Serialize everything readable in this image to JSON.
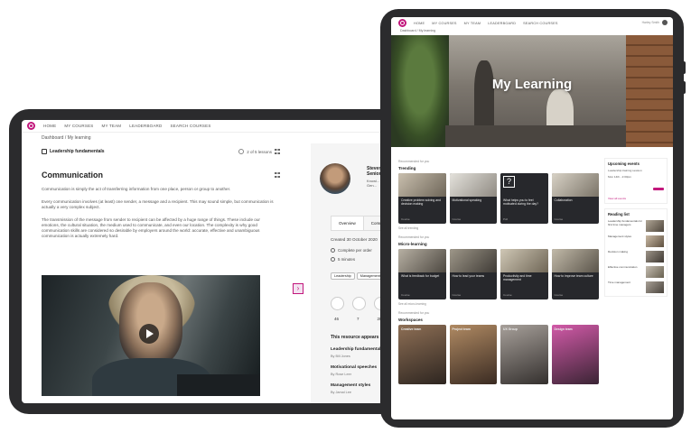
{
  "colors": {
    "brand": "#c2177c",
    "device": "#2b2b2d"
  },
  "landscape": {
    "nav": [
      "HOME",
      "MY COURSES",
      "MY TEAM",
      "LEADERBOARD",
      "SEARCH COURSES"
    ],
    "breadcrumb": "Dashboard  /  My learning",
    "course_title": "Leadership fundamentals",
    "progress_label": "2 of 5 lessons",
    "lesson_title": "Communication",
    "paragraphs": [
      "Communication is simply the act of transferring information from one place, person or group to another.",
      "Every communication involves (at least) one sender, a message and a recipient. This may sound simple, but communication is actually a very complex subject.",
      "The transmission of the message from sender to recipient can be affected by a huge range of things. These include our emotions, the cultural situation, the medium used to communicate, and even our location. The complexity is why good communication skills are considered so desirable by employers around the world: accurate, effective and unambiguous communication is actually extremely hard."
    ],
    "side_toggle_icon": "expand-icon",
    "author": {
      "name": "Steven Senior",
      "meta": "Knowl... at Gen..."
    },
    "tabs": [
      "Overview",
      "Comm"
    ],
    "created": "Created 30 October 2020",
    "info_rows": [
      "Complete per order",
      "5 minutes"
    ],
    "tags": [
      "Leadership",
      "Management"
    ],
    "stats": [
      "46",
      "7",
      "28"
    ],
    "appears_label": "This resource appears in:",
    "related": [
      {
        "title": "Leadership fundamentals",
        "author": "By Bill Jones"
      },
      {
        "title": "Motivational speeches",
        "author": "By Rose Leer"
      },
      {
        "title": "Management styles",
        "author": "By Jamal Lee"
      }
    ]
  },
  "portrait": {
    "nav": [
      "HOME",
      "MY COURSES",
      "MY TEAM",
      "LEADERBOARD",
      "SEARCH COURSES"
    ],
    "user": "Harley Smith",
    "breadcrumb": "Dashboard  /  My learning",
    "hero_title": "My Learning",
    "sections": [
      {
        "small": "Recommended for you",
        "title": "Trending",
        "cards": [
          {
            "title": "Creative problem solving and decision making",
            "type": "Course",
            "thumb": "office"
          },
          {
            "title": "Motivational speaking",
            "type": "Course",
            "thumb": "office"
          },
          {
            "title": "What helps you to feel motivated during the day?",
            "type": "Poll",
            "thumb": "question"
          },
          {
            "title": "Collaboration",
            "type": "Course",
            "thumb": "office"
          }
        ],
        "see_all": "See all trending"
      },
      {
        "small": "Recommended for you",
        "title": "Micro-learning",
        "cards": [
          {
            "title": "What is feedback for budget",
            "type": "Course",
            "thumb": "office"
          },
          {
            "title": "How to lead your teams",
            "type": "Course",
            "thumb": "office"
          },
          {
            "title": "Productivity and time management",
            "type": "Course",
            "thumb": "office"
          },
          {
            "title": "How to improve team culture",
            "type": "Course",
            "thumb": "office"
          }
        ],
        "see_all": "See all micro-learning"
      },
      {
        "small": "Recommended for you",
        "title": "Workspaces",
        "cards": [
          {
            "title": "Creative team",
            "type": "Workspace",
            "thumb": "people"
          },
          {
            "title": "Project team",
            "type": "Workspace",
            "thumb": "people"
          },
          {
            "title": "UX Group",
            "type": "Workspace",
            "thumb": "people"
          },
          {
            "title": "Design team",
            "type": "Workspace",
            "thumb": "people"
          }
        ],
        "see_all": ""
      }
    ],
    "events": {
      "title": "Upcoming events",
      "lines": [
        "Leadership training session",
        "Mon 14th - 2:00pm"
      ],
      "link": "View all events"
    },
    "reading": {
      "title": "Reading list",
      "items": [
        {
          "text": "Leadership fundamentals for first time managers"
        },
        {
          "text": "Management styles"
        },
        {
          "text": "Decision making"
        },
        {
          "text": "Effective communication"
        },
        {
          "text": "Time management"
        }
      ]
    }
  }
}
